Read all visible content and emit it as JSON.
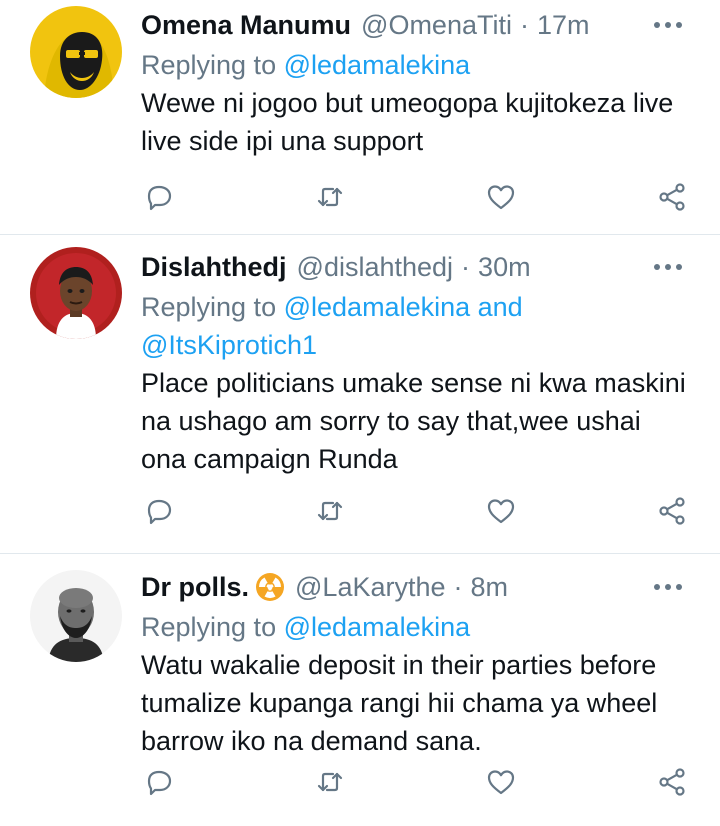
{
  "tweets": [
    {
      "name": "Omena Manumu",
      "handle": "@OmenaTiti",
      "separator": "·",
      "time": "17m",
      "replying_prefix": "Replying to",
      "mentions": [
        "@ledamalekina"
      ],
      "mention_joiner": "",
      "text": "Wewe ni jogoo but umeogopa kujitokeza live live side ipi una support"
    },
    {
      "name": "Dislahthedj",
      "handle": "@dislahthedj",
      "separator": "·",
      "time": "30m",
      "replying_prefix": "Replying to",
      "mentions": [
        "@ledamalekina",
        "@ItsKiprotich1"
      ],
      "mention_joiner": "and",
      "text": "Place politicians umake sense ni kwa maskini na ushago am sorry to say that,wee ushai ona campaign Runda"
    },
    {
      "name": "Dr polls.",
      "handle": "@LaKarythe",
      "separator": "·",
      "time": "8m",
      "replying_prefix": "Replying to",
      "mentions": [
        "@ledamalekina"
      ],
      "mention_joiner": "",
      "text": "Watu wakalie deposit in their parties before tumalize kupanga rangi hii chama ya wheel barrow iko na demand sana."
    }
  ],
  "icons": {
    "more": "more-dots-icon",
    "reply": "reply-icon",
    "retweet": "retweet-icon",
    "like": "like-heart-icon",
    "share": "share-icon",
    "hazard": "radioactive-icon"
  },
  "colors": {
    "link": "#1da1f2",
    "muted": "#657786",
    "text": "#0f1419",
    "divider": "#e1e8ed",
    "hazard_bg": "#f5a623"
  }
}
